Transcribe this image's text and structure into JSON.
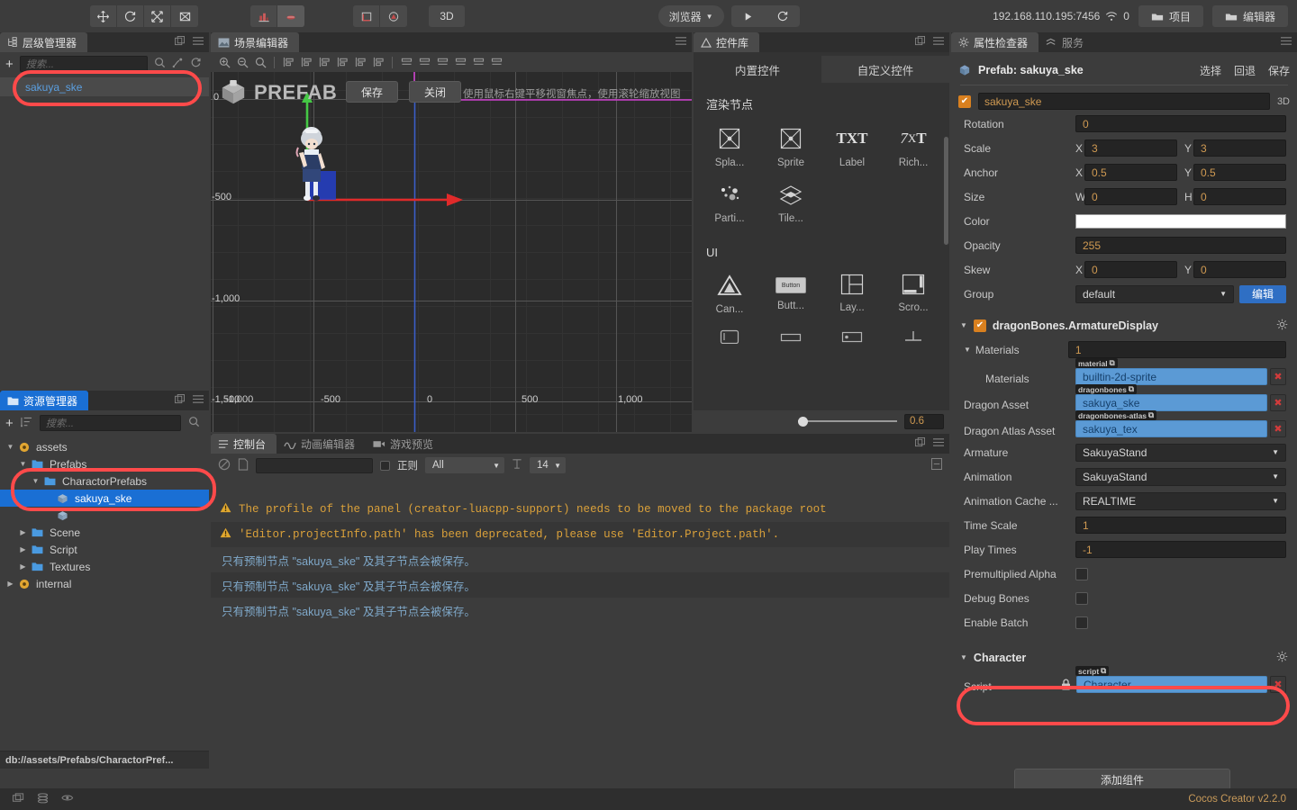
{
  "toolbar": {
    "transform_tools": [
      {
        "name": "move-tool",
        "icon": "move-arrows"
      },
      {
        "name": "rotate-tool",
        "icon": "rotate-circular"
      },
      {
        "name": "scale-tool",
        "icon": "scale-diagonal"
      },
      {
        "name": "rect-tool",
        "icon": "rect-transform"
      }
    ],
    "pivot_tools": [
      {
        "name": "pivot-mode",
        "icon": "pivot"
      },
      {
        "name": "anchor-mode",
        "icon": "anchor"
      }
    ],
    "coord_tools": [
      {
        "name": "local-coords",
        "icon": "local-axis"
      },
      {
        "name": "global-coords",
        "icon": "global-axis"
      }
    ],
    "mode_3d_label": "3D",
    "browser_label": "浏览器",
    "play_icon": "play-triangle",
    "refresh_icon": "refresh-arrow",
    "ip_address": "192.168.110.195:7456",
    "wifi_icon": "wifi-icon",
    "device_count": "0",
    "project_button": "项目",
    "editor_button": "编辑器"
  },
  "hierarchy": {
    "tab_label": "层级管理器",
    "search_placeholder": "搜索...",
    "add_icon": "plus-icon",
    "search_icon": "magnifier-icon",
    "link_icon": "link-icon",
    "refresh_icon": "refresh-icon",
    "nodes": [
      {
        "label": "sakuya_ske",
        "selected": true
      }
    ]
  },
  "assets": {
    "tab_label": "资源管理器",
    "search_placeholder": "搜索...",
    "add_icon": "plus-icon",
    "sort_icon": "sort-icon",
    "search_icon": "magnifier-icon",
    "tree": [
      {
        "label": "assets",
        "depth": 0,
        "kind": "db",
        "expanded": true,
        "selected": false
      },
      {
        "label": "Prefabs",
        "depth": 1,
        "kind": "folder",
        "expanded": true,
        "selected": false
      },
      {
        "label": "CharactorPrefabs",
        "depth": 2,
        "kind": "folder",
        "expanded": true,
        "selected": false
      },
      {
        "label": "sakuya_ske",
        "depth": 3,
        "kind": "prefab",
        "expanded": null,
        "selected": true
      },
      {
        "label": "",
        "depth": 3,
        "kind": "prefab",
        "expanded": null,
        "selected": false
      },
      {
        "label": "Scene",
        "depth": 1,
        "kind": "folder",
        "expanded": false,
        "selected": false
      },
      {
        "label": "Script",
        "depth": 1,
        "kind": "folder",
        "expanded": false,
        "selected": false
      },
      {
        "label": "Textures",
        "depth": 1,
        "kind": "folder",
        "expanded": false,
        "selected": false
      },
      {
        "label": "internal",
        "depth": 0,
        "kind": "db",
        "expanded": false,
        "selected": false
      }
    ],
    "status_path": "db://assets/Prefabs/CharactorPref..."
  },
  "scene": {
    "tab_label": "场景编辑器",
    "tools": [
      {
        "name": "zoom-in-icon"
      },
      {
        "name": "zoom-out-icon"
      },
      {
        "name": "zoom-fit-icon"
      },
      {
        "name": "align-left-icon"
      },
      {
        "name": "align-center-h-icon"
      },
      {
        "name": "align-right-icon"
      },
      {
        "name": "align-top-icon"
      },
      {
        "name": "align-middle-icon"
      },
      {
        "name": "align-bottom-icon"
      },
      {
        "name": "distribute-h-icon"
      },
      {
        "name": "distribute-v-icon"
      },
      {
        "name": "distribute-gap-icon"
      },
      {
        "name": "spread-h-icon"
      },
      {
        "name": "spread-v-icon"
      },
      {
        "name": "spread-both-icon"
      }
    ],
    "prefab_badge": "PREFAB",
    "save_button": "保存",
    "close_button": "关闭",
    "hint_text": "使用鼠标右键平移视窗焦点，使用滚轮缩放视图",
    "y_ticks": [
      "0",
      "-500",
      "-1,000",
      "-1,500"
    ],
    "x_ticks": [
      "-1,000",
      "-500",
      "0",
      "500",
      "1,000"
    ]
  },
  "widgets": {
    "tab_label": "控件库",
    "tabs": [
      {
        "label": "内置控件",
        "active": true
      },
      {
        "label": "自定义控件",
        "active": false
      }
    ],
    "sections": [
      {
        "title": "渲染节点",
        "items": [
          {
            "label": "Spla...",
            "icon": "sprite-splash-icon"
          },
          {
            "label": "Sprite",
            "icon": "sprite-icon"
          },
          {
            "label": "Label",
            "icon": "label-txt-icon"
          },
          {
            "label": "Rich...",
            "icon": "richtext-icon"
          },
          {
            "label": "Parti...",
            "icon": "particle-icon"
          },
          {
            "label": "Tile...",
            "icon": "tilemap-icon"
          }
        ]
      },
      {
        "title": "UI",
        "items": [
          {
            "label": "Can...",
            "icon": "canvas-icon"
          },
          {
            "label": "Butt...",
            "icon": "button-icon"
          },
          {
            "label": "Lay...",
            "icon": "layout-icon"
          },
          {
            "label": "Scro...",
            "icon": "scrollview-icon"
          }
        ]
      }
    ],
    "zoom_value": "0.6"
  },
  "console": {
    "tabs": [
      {
        "label": "控制台",
        "icon": "console-icon",
        "active": true
      },
      {
        "label": "动画编辑器",
        "icon": "anim-icon",
        "active": false
      },
      {
        "label": "游戏预览",
        "icon": "preview-icon",
        "active": false
      }
    ],
    "clear_icon": "clear-circle-icon",
    "file_icon": "file-icon",
    "filter_value": "",
    "regex_label": "正则",
    "level_value": "All",
    "font_size_icon": "text-size-icon",
    "font_size_value": "14",
    "collapse_icon": "collapse-icon",
    "messages": [
      {
        "type": "warn",
        "text": "The profile of the panel (creator-luacpp-support) needs to be moved to the package root"
      },
      {
        "type": "warn",
        "text": "'Editor.projectInfo.path' has been deprecated, please use 'Editor.Project.path'."
      },
      {
        "type": "info",
        "text": "只有预制节点 \"sakuya_ske\" 及其子节点会被保存。"
      },
      {
        "type": "info",
        "text": "只有预制节点 \"sakuya_ske\" 及其子节点会被保存。"
      },
      {
        "type": "info",
        "text": "只有预制节点 \"sakuya_ske\" 及其子节点会被保存。"
      }
    ]
  },
  "inspector": {
    "tabs": [
      {
        "label": "属性检查器",
        "icon": "gear-icon",
        "active": true
      },
      {
        "label": "服务",
        "icon": "services-icon",
        "active": false
      }
    ],
    "prefab_icon": "prefab-icon",
    "prefab_title": "Prefab: sakuya_ske",
    "actions": [
      "选择",
      "回退",
      "保存"
    ],
    "node": {
      "enabled": true,
      "name": "sakuya_ske",
      "mode_3d": "3D"
    },
    "node_props": [
      {
        "label": "Rotation",
        "type": "single",
        "value": "0"
      },
      {
        "label": "Scale",
        "type": "xy",
        "x_key": "X",
        "x": "3",
        "y_key": "Y",
        "y": "3"
      },
      {
        "label": "Anchor",
        "type": "xy",
        "x_key": "X",
        "x": "0.5",
        "y_key": "Y",
        "y": "0.5"
      },
      {
        "label": "Size",
        "type": "xy",
        "x_key": "W",
        "x": "0",
        "y_key": "H",
        "y": "0"
      },
      {
        "label": "Color",
        "type": "color",
        "value": "#ffffff"
      },
      {
        "label": "Opacity",
        "type": "single",
        "value": "255"
      },
      {
        "label": "Skew",
        "type": "xy",
        "x_key": "X",
        "x": "0",
        "y_key": "Y",
        "y": "0"
      },
      {
        "label": "Group",
        "type": "dropdown",
        "value": "default",
        "button": "编辑"
      }
    ],
    "armature_component": {
      "title": "dragonBones.ArmatureDisplay",
      "enabled": true,
      "materials_label": "Materials",
      "materials_count": "1",
      "asset_rows": [
        {
          "label": "Materials",
          "tag": "material",
          "value": "builtin-2d-sprite"
        },
        {
          "label": "Dragon Asset",
          "tag": "dragonbones",
          "value": "sakuya_ske"
        },
        {
          "label": "Dragon Atlas Asset",
          "tag": "dragonbones-atlas",
          "value": "sakuya_tex"
        }
      ],
      "rows": [
        {
          "label": "Armature",
          "type": "dropdown",
          "value": "SakuyaStand"
        },
        {
          "label": "Animation",
          "type": "dropdown",
          "value": "SakuyaStand"
        },
        {
          "label": "Animation Cache ...",
          "type": "dropdown",
          "value": "REALTIME"
        },
        {
          "label": "Time Scale",
          "type": "field",
          "value": "1"
        },
        {
          "label": "Play Times",
          "type": "field",
          "value": "-1"
        },
        {
          "label": "Premultiplied Alpha",
          "type": "checkbox",
          "value": false
        },
        {
          "label": "Debug Bones",
          "type": "checkbox",
          "value": false
        },
        {
          "label": "Enable Batch",
          "type": "checkbox",
          "value": false
        }
      ]
    },
    "character_component": {
      "title": "Character",
      "script_label": "Script",
      "lock_icon": "lock-icon",
      "script_tag": "script",
      "script_value": "Character"
    },
    "add_component_button": "添加组件"
  },
  "footer": {
    "version": "Cocos Creator v2.2.0",
    "icons": [
      "sync-icon",
      "database-icon",
      "eye-icon"
    ]
  },
  "annotations": {
    "color": "#ff4a4a",
    "boxes": [
      "hierarchy-node-highlight",
      "asset-prefab-highlight",
      "script-component-highlight"
    ]
  }
}
